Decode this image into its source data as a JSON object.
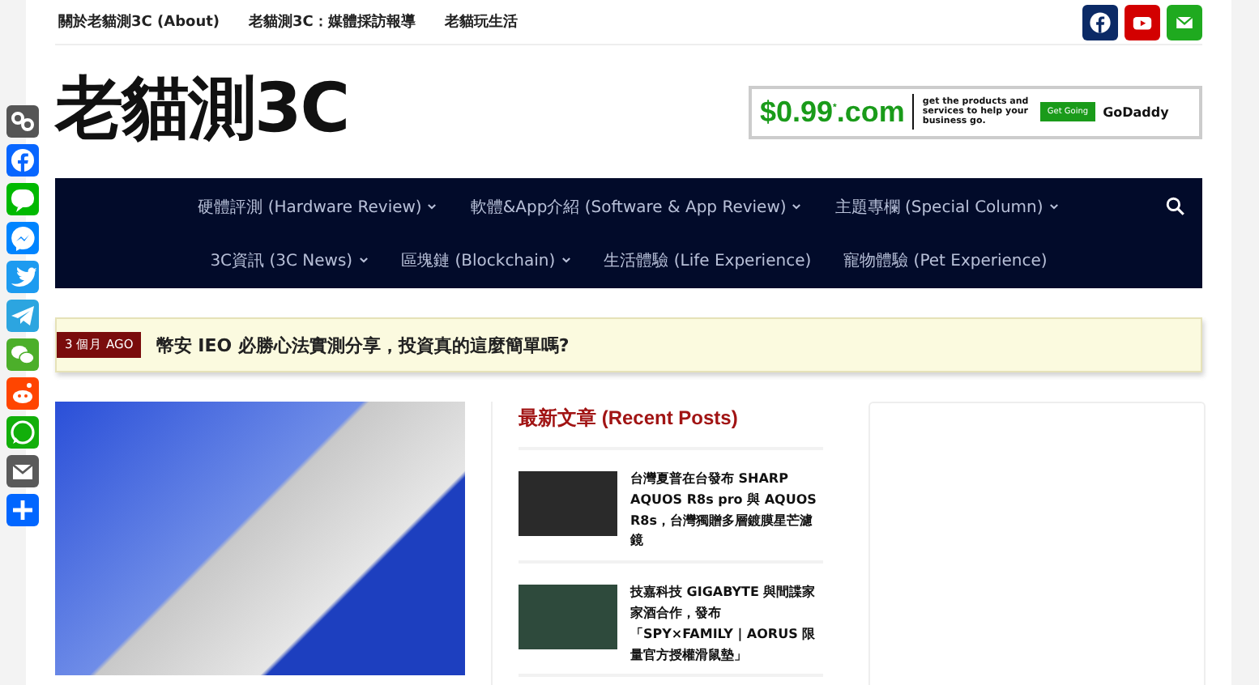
{
  "top_links": [
    "關於老貓測3C (About)",
    "老貓測3C：媒體採訪報導",
    "老貓玩生活"
  ],
  "site_title": "老貓測3C",
  "ad_banner": {
    "price": "$0.99",
    "price_mark": "*",
    "domain": ".com",
    "tagline": "get the products and services to help your business go.",
    "cta": "Get Going",
    "brand": "GoDaddy"
  },
  "nav": {
    "items": [
      {
        "label": "硬體評測 (Hardware Review)",
        "has_submenu": true
      },
      {
        "label": "軟體&App介紹 (Software & App Review)",
        "has_submenu": true
      },
      {
        "label": "主題專欄 (Special Column)",
        "has_submenu": true
      },
      {
        "label": "3C資訊 (3C News)",
        "has_submenu": true
      },
      {
        "label": "區塊鏈 (Blockchain)",
        "has_submenu": true
      },
      {
        "label": "生活體驗 (Life Experience)",
        "has_submenu": false
      },
      {
        "label": "寵物體驗 (Pet Experience)",
        "has_submenu": false
      }
    ]
  },
  "ticker": {
    "badge": "3 個月 AGO",
    "headline": "幣安 IEO 必勝心法實測分享，投資真的這麼簡單嗎?"
  },
  "recent_posts": {
    "title": "最新文章 (Recent Posts)",
    "items": [
      {
        "title": "台灣夏普在台發布 SHARP AQUOS R8s pro 與 AQUOS R8s，台灣獨贈多層鍍膜星芒濾鏡"
      },
      {
        "title": "技嘉科技 GIGABYTE 與間諜家家酒合作，發布「SPY×FAMILY | AORUS 限量官方授權滑鼠墊」"
      }
    ]
  }
}
